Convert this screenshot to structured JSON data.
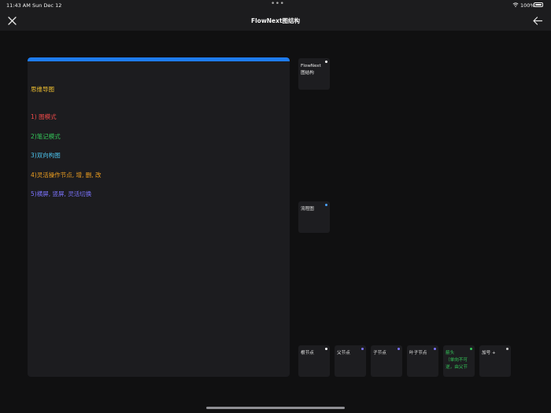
{
  "status_bar": {
    "time": "11:43 AM",
    "date": "Sun Dec 12",
    "dots": "•••",
    "battery": "100%"
  },
  "nav": {
    "title": "FlowNext图结构",
    "close_icon": "close-icon",
    "back_icon": "arrow-left-icon"
  },
  "colors": {
    "accent": "#1e7cf0",
    "yellow": "#f2c230",
    "red": "#f04a4a",
    "green": "#34c759",
    "cyan": "#4cc3ee",
    "orange": "#f0a020",
    "purple": "#7c74ff",
    "white": "#ffffff"
  },
  "panel": {
    "lines": [
      {
        "text": "思维导图",
        "color": "#f2c230"
      },
      {
        "text": "1) 图模式",
        "color": "#f04a4a"
      },
      {
        "text": "2)笔记模式",
        "color": "#34c759"
      },
      {
        "text": "3)双向构图",
        "color": "#4cc3ee"
      },
      {
        "text": "4)灵活操作节点, 增, 删, 改",
        "color": "#f0a020"
      },
      {
        "text": "5)横屏, 竖屏, 灵活切换",
        "color": "#7c74ff"
      }
    ]
  },
  "side_tiles": [
    {
      "text": "FlowNext\n图结构",
      "dot": "#ffffff",
      "text_color": "#e8e8e8"
    },
    {
      "text": "流程图",
      "dot": "#4aa3ff",
      "text_color": "#e8e8e8"
    }
  ],
  "bottom_tiles": [
    {
      "text": "根节点",
      "dot": "#ffffff",
      "text_color": "#e8e8e8"
    },
    {
      "text": "父节点",
      "dot": "#7c74ff",
      "text_color": "#e8e8e8"
    },
    {
      "text": "子节点",
      "dot": "#7c74ff",
      "text_color": "#e8e8e8"
    },
    {
      "text": "叶子节点",
      "dot": "#7c74ff",
      "text_color": "#e8e8e8"
    },
    {
      "text": "箭头\n（单向不可逆，由父节",
      "dot": "#34c759",
      "text_color": "#34c759"
    },
    {
      "text": "加号 +",
      "dot": "#cccccc",
      "text_color": "#e8e8e8"
    }
  ]
}
